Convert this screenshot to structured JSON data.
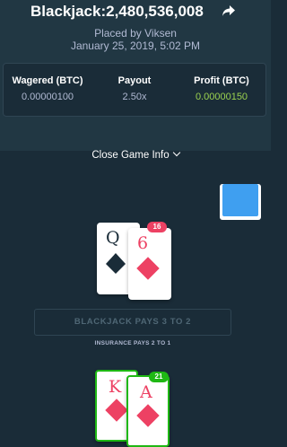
{
  "header": {
    "title": "Blackjack:2,480,536,008",
    "placed_by": "Placed by Viksen",
    "date": "January 25, 2019, 5:02 PM"
  },
  "stats": {
    "wagered_label": "Wagered (BTC)",
    "wagered_value": "0.00000100",
    "payout_label": "Payout",
    "payout_value": "2.50x",
    "profit_label": "Profit (BTC)",
    "profit_value": "0.00000150"
  },
  "close_info_label": "Close Game Info",
  "dealer": {
    "score": "16",
    "cards": [
      {
        "rank": "Q",
        "suit": "spade"
      },
      {
        "rank": "6",
        "suit": "diamond"
      }
    ]
  },
  "banner_text": "BLACKJACK PAYS 3 TO 2",
  "insurance_text": "INSURANCE PAYS 2 TO 1",
  "player": {
    "score": "21",
    "cards": [
      {
        "rank": "K",
        "suit": "diamond"
      },
      {
        "rank": "A",
        "suit": "diamond"
      }
    ]
  },
  "colors": {
    "background": "#1a2c38",
    "header": "#213743",
    "profit_green": "#9bd24f",
    "diamond_red": "#ed4163",
    "win_green": "#1fb814",
    "deck_blue": "#3f9ff0"
  },
  "icons": [
    "share-icon",
    "chevron-down-icon",
    "spade-icon",
    "diamond-icon"
  ]
}
